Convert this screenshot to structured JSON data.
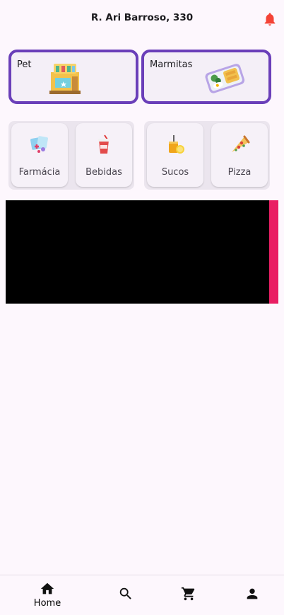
{
  "header": {
    "address": "R. Ari Barroso, 330",
    "bell_icon": "bell-icon",
    "bell_color": "#f44336"
  },
  "featured": [
    {
      "label": "Pet",
      "icon": "pet-shop-icon"
    },
    {
      "label": "Marmitas",
      "icon": "lunchbox-icon"
    }
  ],
  "categories": [
    {
      "label": "Farmácia",
      "icon": "pharmacy-icon"
    },
    {
      "label": "Bebidas",
      "icon": "soda-cup-icon"
    },
    {
      "label": "Sucos",
      "icon": "juice-icon"
    },
    {
      "label": "Pizza",
      "icon": "pizza-icon"
    }
  ],
  "banner": {
    "color": "#000000",
    "accent": "#e91e63"
  },
  "bottom_nav": {
    "items": [
      {
        "label": "Home",
        "icon": "home-icon"
      },
      {
        "icon": "search-icon"
      },
      {
        "icon": "cart-icon"
      },
      {
        "icon": "person-icon"
      }
    ]
  },
  "colors": {
    "accent": "#6a3fb9",
    "background": "#fdf7fd"
  }
}
